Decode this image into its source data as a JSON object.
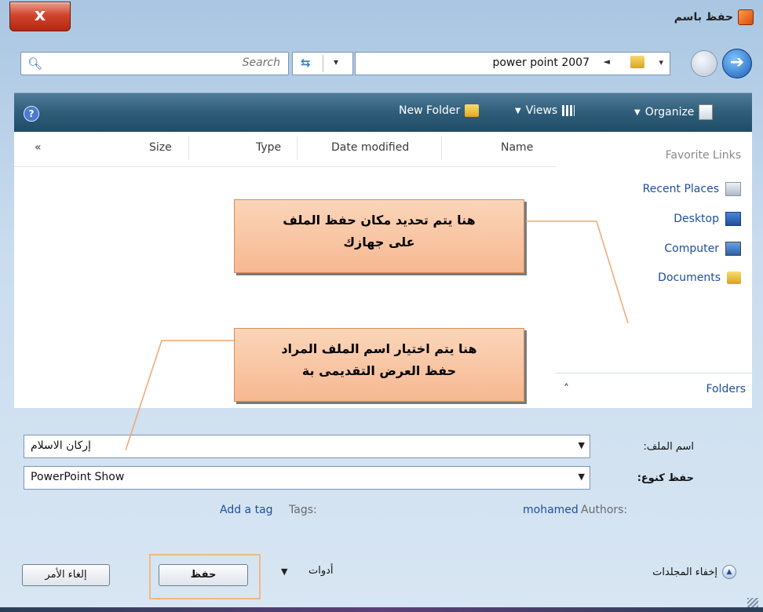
{
  "window": {
    "title": "حفظ باسم",
    "close_label": "x"
  },
  "address_bar": {
    "search_placeholder": "Search",
    "path_text": "power point 2007",
    "path_separator": "◄"
  },
  "toolbar": {
    "organize_label": "Organize",
    "views_label": "Views",
    "new_folder_label": "New Folder",
    "help_label": "?"
  },
  "file_list": {
    "columns": [
      "Name",
      "Date modified",
      "Type",
      "Size"
    ],
    "collapse_label": "«"
  },
  "favorites": {
    "title": "Favorite Links",
    "items": [
      {
        "label": "Recent Places",
        "icon": "recent-places-icon"
      },
      {
        "label": "Desktop",
        "icon": "desktop-icon"
      },
      {
        "label": "Computer",
        "icon": "computer-icon"
      },
      {
        "label": "Documents",
        "icon": "documents-folder-icon"
      }
    ],
    "folders_label": "Folders"
  },
  "form": {
    "filename_label": "اسم الملف:",
    "filename_value": "إركان الاسلام",
    "filetype_label": "حفظ كنوع:",
    "filetype_value": "PowerPoint Show",
    "authors_label": "Authors:",
    "authors_value": "mohamed",
    "tags_label": "Tags:",
    "tags_value": "Add a tag"
  },
  "footer": {
    "hide_folders_label": "إخفاء المجلدات",
    "tools_label": "أدوات",
    "save_label": "حفظ",
    "cancel_label": "إلغاء الأمر"
  },
  "callouts": {
    "location_line1": "هنا يتم تحديد مكان حفظ الملف",
    "location_line2": "على جهازك",
    "filename_line1": "هنا يتم اختيار اسم الملف المراد",
    "filename_line2": "حفظ العرض التقديمى بة"
  },
  "colors": {
    "toolbar": "#2f5d79",
    "link": "#1d4fa0",
    "callout_fill": "#f8c6a3",
    "callout_border": "#dd8b5b",
    "close_button": "#c8351f"
  }
}
